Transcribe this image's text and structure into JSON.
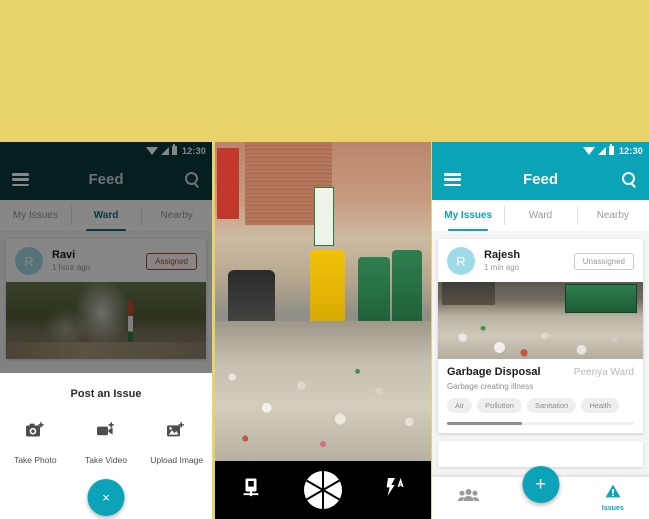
{
  "theme": {
    "background": "#e8d26a",
    "accent": "#0ba3b8",
    "accent_dim": "#0b3a3c",
    "badge_assigned": "#a8462c",
    "avatar": "#9fdbe6"
  },
  "status_bar": {
    "time": "12:30",
    "icons": [
      "wifi-icon",
      "signal-icon",
      "battery-icon"
    ]
  },
  "left_phone": {
    "appbar": {
      "menu_icon": "hamburger-icon",
      "title": "Feed",
      "search_icon": "search-icon"
    },
    "tabs": [
      {
        "label": "My Issues",
        "active": false
      },
      {
        "label": "Ward",
        "active": true
      },
      {
        "label": "Nearby",
        "active": false
      }
    ],
    "card": {
      "avatar_initial": "R",
      "user": "Ravi",
      "time": "1 hour ago",
      "status": "Assigned"
    },
    "sheet": {
      "title": "Post an Issue",
      "actions": [
        {
          "label": "Take Photo",
          "icon": "camera-add-icon"
        },
        {
          "label": "Take Video",
          "icon": "video-add-icon"
        },
        {
          "label": "Upload Image",
          "icon": "image-add-icon"
        }
      ],
      "close_label": "×",
      "close_icon": "close-icon"
    }
  },
  "mid_phone": {
    "camera_bar": [
      {
        "icon": "switch-camera-icon",
        "label": ""
      },
      {
        "icon": "shutter-icon",
        "label": ""
      },
      {
        "icon": "flash-auto-icon",
        "label": ""
      }
    ]
  },
  "right_phone": {
    "appbar": {
      "menu_icon": "hamburger-icon",
      "title": "Feed",
      "search_icon": "search-icon"
    },
    "tabs": [
      {
        "label": "My Issues",
        "active": true
      },
      {
        "label": "Ward",
        "active": false
      },
      {
        "label": "Nearby",
        "active": false
      }
    ],
    "card": {
      "avatar_initial": "R",
      "user": "Rajesh",
      "time": "1 min ago",
      "status": "Unassigned",
      "title": "Garbage Disposal",
      "ward": "Peenya Ward",
      "description": "Garbage creating illness",
      "tags": [
        "Air",
        "Pollution",
        "Sanitation",
        "Health"
      ],
      "progress_percent": 40
    },
    "bottom_nav": {
      "left": {
        "icon": "people-icon",
        "label": ""
      },
      "fab": {
        "icon": "plus-icon",
        "label": "+"
      },
      "right": {
        "icon": "warning-triangle-icon",
        "label": "Issues"
      }
    }
  }
}
